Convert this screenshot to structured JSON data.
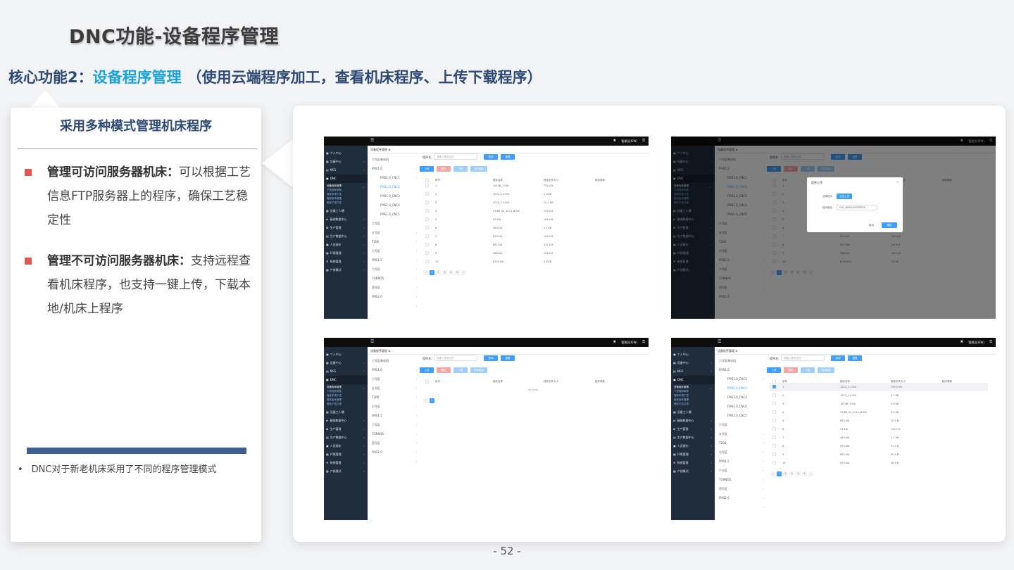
{
  "slide": {
    "title": "DNC功能-设备程序管理",
    "subtitle_prefix": "核心功能2：",
    "subtitle_highlight": "设备程序管理",
    "subtitle_paren": "（使用云端程序加工，查看机床程序、上传下载程序）",
    "page_number": "- 52 -"
  },
  "left_card": {
    "heading": "采用多种模式管理机床程序",
    "bullets": [
      {
        "bold": "管理可访问服务器机床：",
        "text": "可以根据工艺信息FTP服务器上的程序，确保工艺稳定性"
      },
      {
        "bold": "管理不可访问服务器机床：",
        "text": "支持远程查看机床程序，也支持一键上传，下载本地/机床上程序"
      }
    ],
    "footnote_dot": "•",
    "footnote": "DNC对于新老机床采用了不同的程序管理模式"
  },
  "app": {
    "menu_icon": "☰",
    "close_icon": "✖",
    "user": "管理员(IEW)",
    "key_icon": "⚿",
    "tab": "设备程序管理 ⊗",
    "search_label": "程序名:",
    "search_placeholder": "请输入程序名称",
    "btn_search": "查询",
    "btn_reset": "重置",
    "btn_upload": "上传",
    "btn_delete": "删除",
    "btn_download": "下载",
    "btn_sync": "同步程序",
    "table_headers": [
      "序号",
      "程序名称",
      "程序文件大小",
      "程序更新"
    ],
    "no_data": "No Data",
    "sidebar": [
      {
        "label": "个人中心",
        "icon": "▣",
        "chev": "‹"
      },
      {
        "label": "设备中心",
        "icon": "▦",
        "chev": "‹"
      },
      {
        "label": "MES",
        "icon": "▤",
        "chev": "‹"
      },
      {
        "label": "DNC",
        "icon": "▣",
        "chev": "⌄"
      },
      {
        "label": "设备工人播",
        "icon": "▦",
        "chev": "‹"
      },
      {
        "label": "基础数据中心",
        "icon": "⇄",
        "chev": "‹"
      },
      {
        "label": "生产管理",
        "icon": "✿",
        "chev": "‹"
      },
      {
        "label": "生产数据中心",
        "icon": "▤",
        "chev": "‹"
      },
      {
        "label": "人员报价",
        "icon": "▣",
        "chev": "‹"
      },
      {
        "label": "环境管理",
        "icon": "▦",
        "chev": "‹"
      },
      {
        "label": "系统管理",
        "icon": "✲",
        "chev": "‹"
      },
      {
        "label": "产线模式",
        "icon": "▦",
        "chev": ""
      }
    ],
    "dnc_sub": [
      "设备程序管理",
      "下发程序审核",
      "程序申请下发",
      "程序版本管理",
      "程序下发记录"
    ],
    "tree_top": "六号区装站机",
    "tree_machine": "FMS1.0",
    "tree_children": [
      "FMS1.0_CNC1",
      "FMS1.0_CNC2",
      "FMS1.0_CNC3",
      "FMS1.0_CNC4",
      "FMS1.0_CNC5"
    ],
    "tree_others": [
      "六号区",
      "五号区",
      "T208",
      "七号区",
      "FMS1.5",
      "六号区",
      "TORNOS",
      "西号区",
      "FMS2.0"
    ],
    "rows": [
      {
        "no": "1",
        "name": "1014B_7.EIA",
        "size": "730.0 B"
      },
      {
        "no": "2",
        "name": "1074_2.2.EIA",
        "size": "1.0 KB"
      },
      {
        "no": "3",
        "name": "1074_2.3.EIA",
        "size": "13.2 KB"
      },
      {
        "no": "4",
        "name": "53/86_52_1074_B.EIA",
        "size": "295.0 B"
      },
      {
        "no": "5",
        "name": "53.EIA",
        "size": "194.0 B"
      },
      {
        "no": "6",
        "name": "463.EIA",
        "size": "1.7 KB"
      },
      {
        "no": "7",
        "name": "870.EIA",
        "size": "144.0 B"
      },
      {
        "no": "8",
        "name": "887.EIA",
        "size": "147.0 B"
      },
      {
        "no": "9",
        "name": "986.EIA",
        "size": "106.0 B"
      },
      {
        "no": "10",
        "name": "8700.EIA",
        "size": "1.6 KB"
      }
    ],
    "rows_alt": [
      {
        "no": "1",
        "name": "1014_2.1.EIA",
        "size": "795.0 KB"
      },
      {
        "no": "2",
        "name": "1074_2.2.EIA",
        "size": "3.7 KB"
      },
      {
        "no": "3",
        "name": "1014B_7.EIA",
        "size": "1.6 KB"
      },
      {
        "no": "4",
        "name": "53/86_52_1014_B.EIA",
        "size": "2.2 KB"
      },
      {
        "no": "5",
        "name": "870.EIA",
        "size": "10.0 B"
      },
      {
        "no": "6",
        "name": "53.EIA",
        "size": "194.0 B"
      },
      {
        "no": "7",
        "name": "463.EIA",
        "size": "1.7 KB"
      },
      {
        "no": "8",
        "name": "870.EIA",
        "size": "91.0 B"
      },
      {
        "no": "9",
        "name": "870.EIA",
        "size": "90.0 B"
      },
      {
        "no": "10",
        "name": "870.EIA",
        "size": "98.0 B"
      }
    ],
    "pages": [
      "‹",
      "1",
      "2",
      "3",
      "4",
      "5",
      "›"
    ],
    "modal": {
      "title": "程序上传",
      "close": "×",
      "file_label": "选择程序",
      "file_button": "点击上传",
      "path_label": "程序路径",
      "path_value": "/CNC_MEM/USER/PATH1/ ⌄",
      "cancel": "取消",
      "confirm": "确定"
    }
  }
}
